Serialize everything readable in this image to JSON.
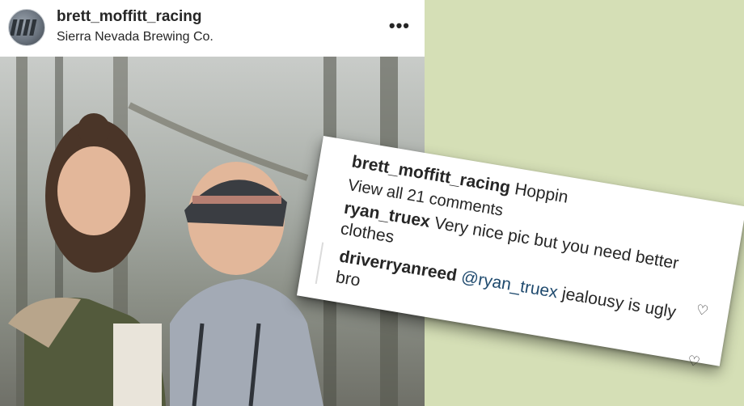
{
  "post": {
    "username": "brett_moffitt_racing",
    "location": "Sierra Nevada Brewing Co.",
    "more_label": "•••"
  },
  "comments_card": {
    "caption": {
      "author": "brett_moffitt_racing",
      "text": "Hoppin"
    },
    "view_all": "View all 21 comments",
    "comments": [
      {
        "author": "ryan_truex",
        "text_line1": "Very nice pic but you need better",
        "text_line2": "clothes"
      },
      {
        "author": "driverryanreed",
        "mention": "@ryan_truex",
        "text_line1": "jealousy is ugly",
        "text_line2": "bro"
      }
    ]
  },
  "colors": {
    "background": "#d5dfb6",
    "text": "#262626",
    "muted": "#8e8e8e",
    "mention": "#1f4a6e"
  },
  "icons": [
    "avatar",
    "more-options-icon",
    "heart-icon"
  ]
}
